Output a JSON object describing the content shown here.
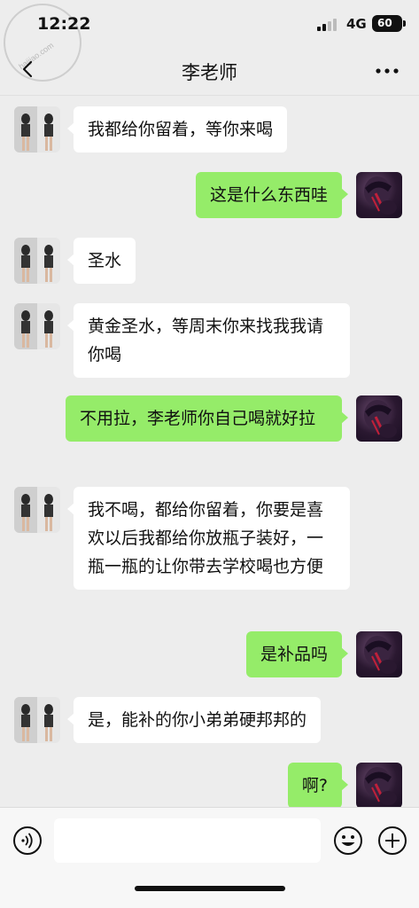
{
  "status_bar": {
    "time": "12:22",
    "network": "4G",
    "battery": "60",
    "watermark": "haijiao.com"
  },
  "nav": {
    "title": "李老师",
    "back_icon": "chevron-left-icon",
    "more_icon": "more-dots-icon"
  },
  "messages": [
    {
      "side": "peer",
      "text": "我都给你留着，等你来喝"
    },
    {
      "side": "self",
      "text": "这是什么东西哇"
    },
    {
      "side": "peer",
      "text": "圣水"
    },
    {
      "side": "peer",
      "text": "黄金圣水，等周末你来找我我请你喝"
    },
    {
      "side": "self",
      "text": "不用拉，李老师你自己喝就好拉"
    },
    {
      "side": "peer",
      "text": "我不喝，都给你留着，你要是喜欢以后我都给你放瓶子装好，一瓶一瓶的让你带去学校喝也方便"
    },
    {
      "side": "self",
      "text": "是补品吗"
    },
    {
      "side": "peer",
      "text": "是，能补的你小弟弟硬邦邦的"
    },
    {
      "side": "self",
      "text": "啊?"
    }
  ],
  "input_bar": {
    "voice_icon": "voice-icon",
    "input_value": "",
    "emoji_icon": "emoji-icon",
    "plus_icon": "plus-icon"
  },
  "colors": {
    "background": "#ededed",
    "self_bubble": "#95ec69",
    "peer_bubble": "#ffffff"
  }
}
